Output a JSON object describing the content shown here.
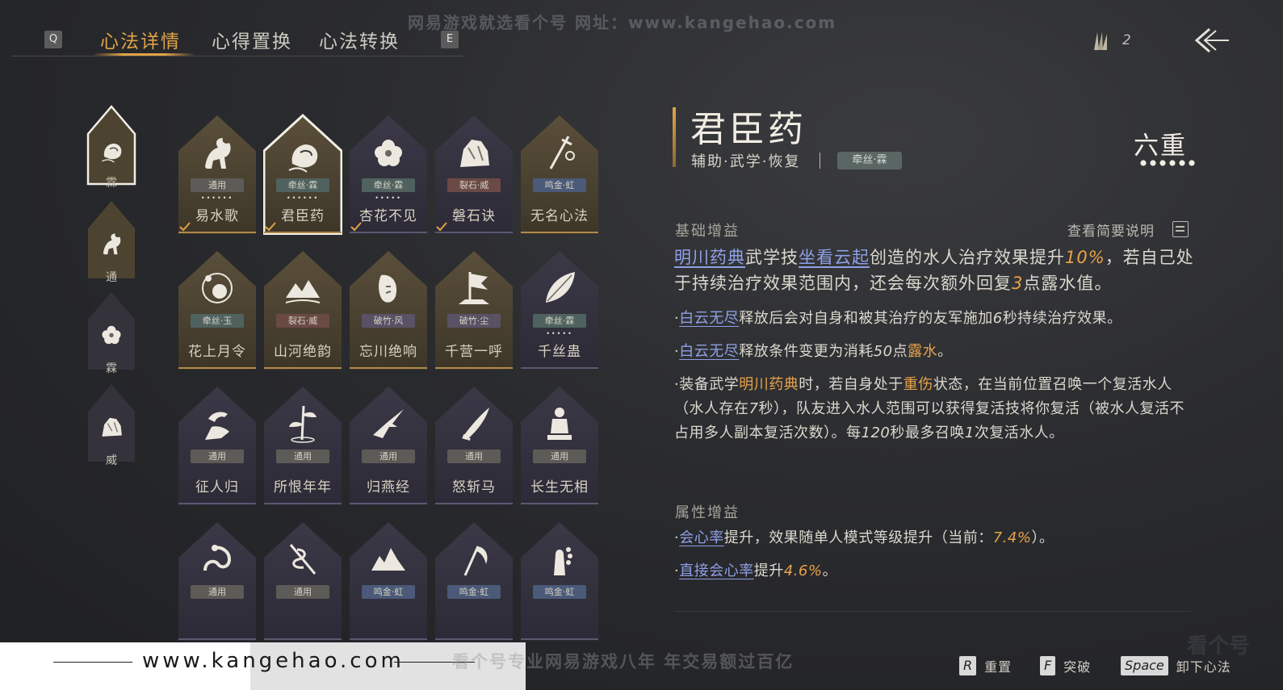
{
  "topbar": {
    "watermark": "网易游戏就选看个号   网址：www.kangehao.com",
    "key_left": "Q",
    "key_right": "E",
    "tabs": [
      {
        "label": "心法详情",
        "active": true
      },
      {
        "label": "心得置换",
        "active": false
      },
      {
        "label": "心法转换",
        "active": false
      }
    ],
    "resource_count": "2",
    "resource_icon": "feather-token-icon",
    "back_icon": "back-arrow-icon"
  },
  "sidebar": [
    {
      "label": "霖",
      "icon": "water-pot-icon",
      "selected": true
    },
    {
      "label": "通",
      "icon": "horse-icon",
      "selected": false
    },
    {
      "label": "霖",
      "icon": "flower-icon",
      "selected": false
    },
    {
      "label": "威",
      "icon": "rock-icon",
      "selected": false
    }
  ],
  "cards": [
    {
      "name": "易水歌",
      "tag": "通用",
      "tag_type": "gray",
      "dots": "••••••",
      "icon": "horse-icon",
      "equipped": true,
      "selected": false,
      "gold": true
    },
    {
      "name": "君臣药",
      "tag": "牵丝·霖",
      "tag_type": "teal",
      "dots": "••••••",
      "icon": "water-pot-icon",
      "equipped": true,
      "selected": true,
      "gold": true
    },
    {
      "name": "杏花不见",
      "tag": "牵丝·霖",
      "tag_type": "teal",
      "dots": "•••••",
      "icon": "flower-icon",
      "equipped": true,
      "selected": false,
      "gold": false
    },
    {
      "name": "磐石诀",
      "tag": "裂石·威",
      "tag_type": "red",
      "dots": "",
      "icon": "rock-icon",
      "equipped": true,
      "selected": false,
      "gold": false
    },
    {
      "name": "无名心法",
      "tag": "鸣金·虹",
      "tag_type": "blue",
      "dots": "",
      "icon": "sword-icon",
      "equipped": false,
      "selected": false,
      "gold": true
    },
    {
      "name": "花上月令",
      "tag": "牵丝·玉",
      "tag_type": "teal",
      "dots": "",
      "icon": "moon-flower-icon",
      "equipped": false,
      "selected": false,
      "gold": true
    },
    {
      "name": "山河绝韵",
      "tag": "裂石·威",
      "tag_type": "red",
      "dots": "",
      "icon": "mountain-icon",
      "equipped": false,
      "selected": false,
      "gold": true
    },
    {
      "name": "忘川绝响",
      "tag": "破竹·风",
      "tag_type": "purple",
      "dots": "",
      "icon": "mask-icon",
      "equipped": false,
      "selected": false,
      "gold": true
    },
    {
      "name": "千营一呼",
      "tag": "破竹·尘",
      "tag_type": "purple",
      "dots": "",
      "icon": "banner-icon",
      "equipped": false,
      "selected": false,
      "gold": true
    },
    {
      "name": "千丝蛊",
      "tag": "牵丝·霖",
      "tag_type": "teal",
      "dots": "•••••",
      "icon": "leaf-icon",
      "equipped": false,
      "selected": false,
      "gold": false
    },
    {
      "name": "征人归",
      "tag": "通用",
      "tag_type": "gray",
      "dots": "",
      "icon": "bird-hand-icon",
      "equipped": false,
      "selected": false,
      "gold": false
    },
    {
      "name": "所恨年年",
      "tag": "通用",
      "tag_type": "gray",
      "dots": "",
      "icon": "bamboo-icon",
      "equipped": false,
      "selected": false,
      "gold": false
    },
    {
      "name": "归燕经",
      "tag": "通用",
      "tag_type": "gray",
      "dots": "",
      "icon": "swallow-icon",
      "equipped": false,
      "selected": false,
      "gold": false
    },
    {
      "name": "怒斩马",
      "tag": "通用",
      "tag_type": "gray",
      "dots": "",
      "icon": "blade-icon",
      "equipped": false,
      "selected": false,
      "gold": false
    },
    {
      "name": "长生无相",
      "tag": "通用",
      "tag_type": "gray",
      "dots": "",
      "icon": "statue-icon",
      "equipped": false,
      "selected": false,
      "gold": false
    },
    {
      "name": "",
      "tag": "通用",
      "tag_type": "gray",
      "dots": "",
      "icon": "dragon-icon",
      "equipped": false,
      "selected": false,
      "gold": false
    },
    {
      "name": "",
      "tag": "通用",
      "tag_type": "gray",
      "dots": "",
      "icon": "snake-staff-icon",
      "equipped": false,
      "selected": false,
      "gold": false
    },
    {
      "name": "",
      "tag": "鸣金·虹",
      "tag_type": "blue",
      "dots": "",
      "icon": "peaks-icon",
      "equipped": false,
      "selected": false,
      "gold": false
    },
    {
      "name": "",
      "tag": "鸣金·虹",
      "tag_type": "blue",
      "dots": "",
      "icon": "scythe-icon",
      "equipped": false,
      "selected": false,
      "gold": false
    },
    {
      "name": "",
      "tag": "鸣金·虹",
      "tag_type": "blue",
      "dots": "",
      "icon": "prayer-hand-icon",
      "equipped": false,
      "selected": false,
      "gold": false
    }
  ],
  "detail": {
    "title": "君臣药",
    "meta": "辅助·武学·恢复",
    "tag": "牵丝·霖",
    "rank": "六重",
    "rank_dots": 6,
    "basic_header": "基础增益",
    "view_brief": "查看简要说明",
    "attr_header": "属性增益"
  },
  "colors": {
    "accent": "#e0a347",
    "link": "#8fa0e6",
    "highlight": "#e8a24a"
  },
  "footer": {
    "url": "www.kangehao.com",
    "watermark": "看个号专业网易游戏八年   年交易额过百亿",
    "corner_watermark": "看个号",
    "hints": [
      {
        "key": "R",
        "label": "重置"
      },
      {
        "key": "F",
        "label": "突破"
      },
      {
        "key": "Space",
        "label": "卸下心法"
      }
    ]
  }
}
